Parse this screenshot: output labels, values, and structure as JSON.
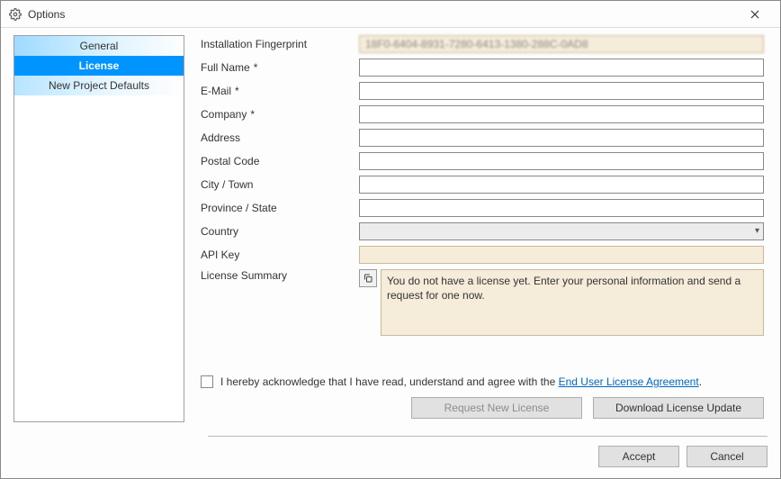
{
  "window": {
    "title": "Options"
  },
  "sidebar": {
    "general": "General",
    "license": "License",
    "newproj": "New Project Defaults"
  },
  "labels": {
    "fingerprint": "Installation Fingerprint",
    "fullname": "Full Name",
    "email": "E-Mail",
    "company": "Company",
    "address": "Address",
    "postal": "Postal Code",
    "city": "City / Town",
    "province": "Province / State",
    "country": "Country",
    "apikey": "API Key",
    "summary": "License Summary",
    "req": "*"
  },
  "values": {
    "fingerprint": "18F0-6404-8931-7280-6413-1380-288C-0AD8",
    "fullname": "",
    "email": "",
    "company": "",
    "address": "",
    "postal": "",
    "city": "",
    "province": "",
    "country": "",
    "apikey": "",
    "summary": "You do not have a license yet. Enter your personal information and send a request for one now."
  },
  "ack": {
    "prefix": "I hereby acknowledge that I have read, understand and agree with the ",
    "link": "End User License Agreement",
    "suffix": "."
  },
  "buttons": {
    "request": "Request New License",
    "download": "Download License Update",
    "accept": "Accept",
    "cancel": "Cancel"
  }
}
